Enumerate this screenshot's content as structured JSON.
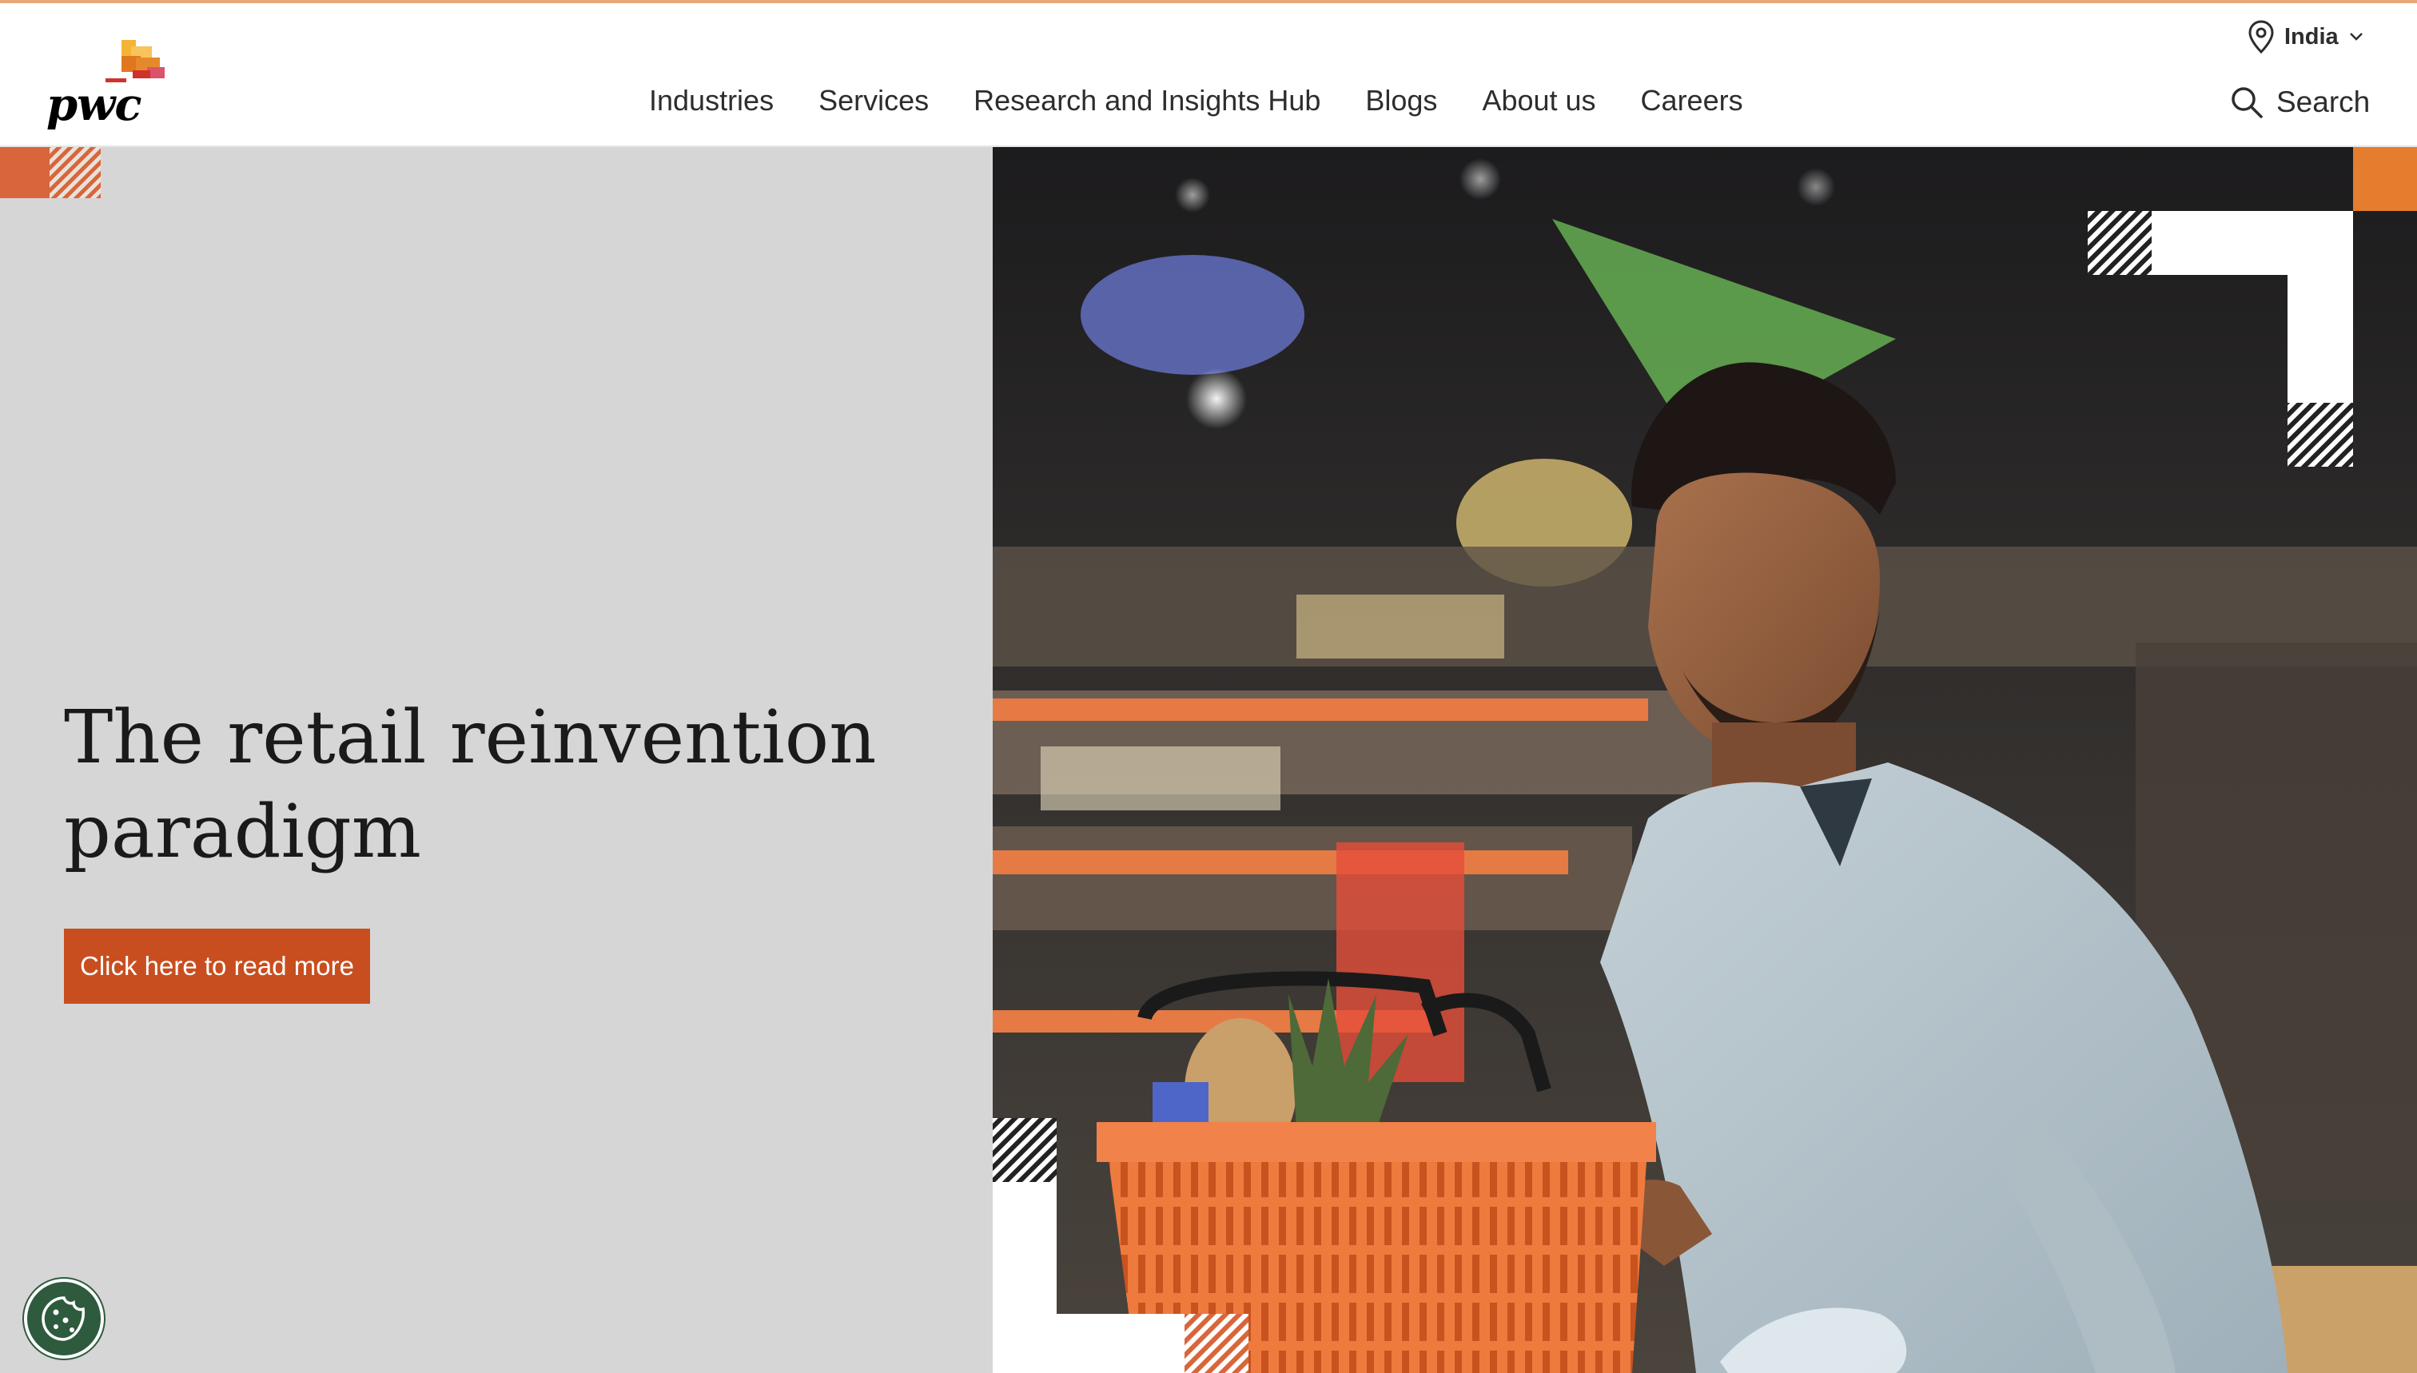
{
  "brand": {
    "name": "pwc",
    "colors": {
      "accent_orange": "#c94e1f",
      "logo_yellow": "#f5b335",
      "logo_orange": "#e0771f",
      "logo_red": "#d0322c",
      "logo_pink": "#db536a",
      "hero_grey": "#d6d6d6",
      "cookie_green": "#2e5a3e"
    }
  },
  "header": {
    "territory": {
      "label": "India",
      "icon": "location-pin-icon",
      "chevron": "chevron-down-icon"
    },
    "nav": [
      {
        "label": "Industries"
      },
      {
        "label": "Services"
      },
      {
        "label": "Research and Insights Hub"
      },
      {
        "label": "Blogs"
      },
      {
        "label": "About us"
      },
      {
        "label": "Careers"
      }
    ],
    "search": {
      "label": "Search",
      "icon": "search-icon"
    }
  },
  "hero": {
    "title": "The retail reinvention paradigm",
    "cta_label": "Click here to read more",
    "image": "shopper-with-orange-basket-photo"
  },
  "cookie_button": {
    "icon": "cookie-icon"
  }
}
